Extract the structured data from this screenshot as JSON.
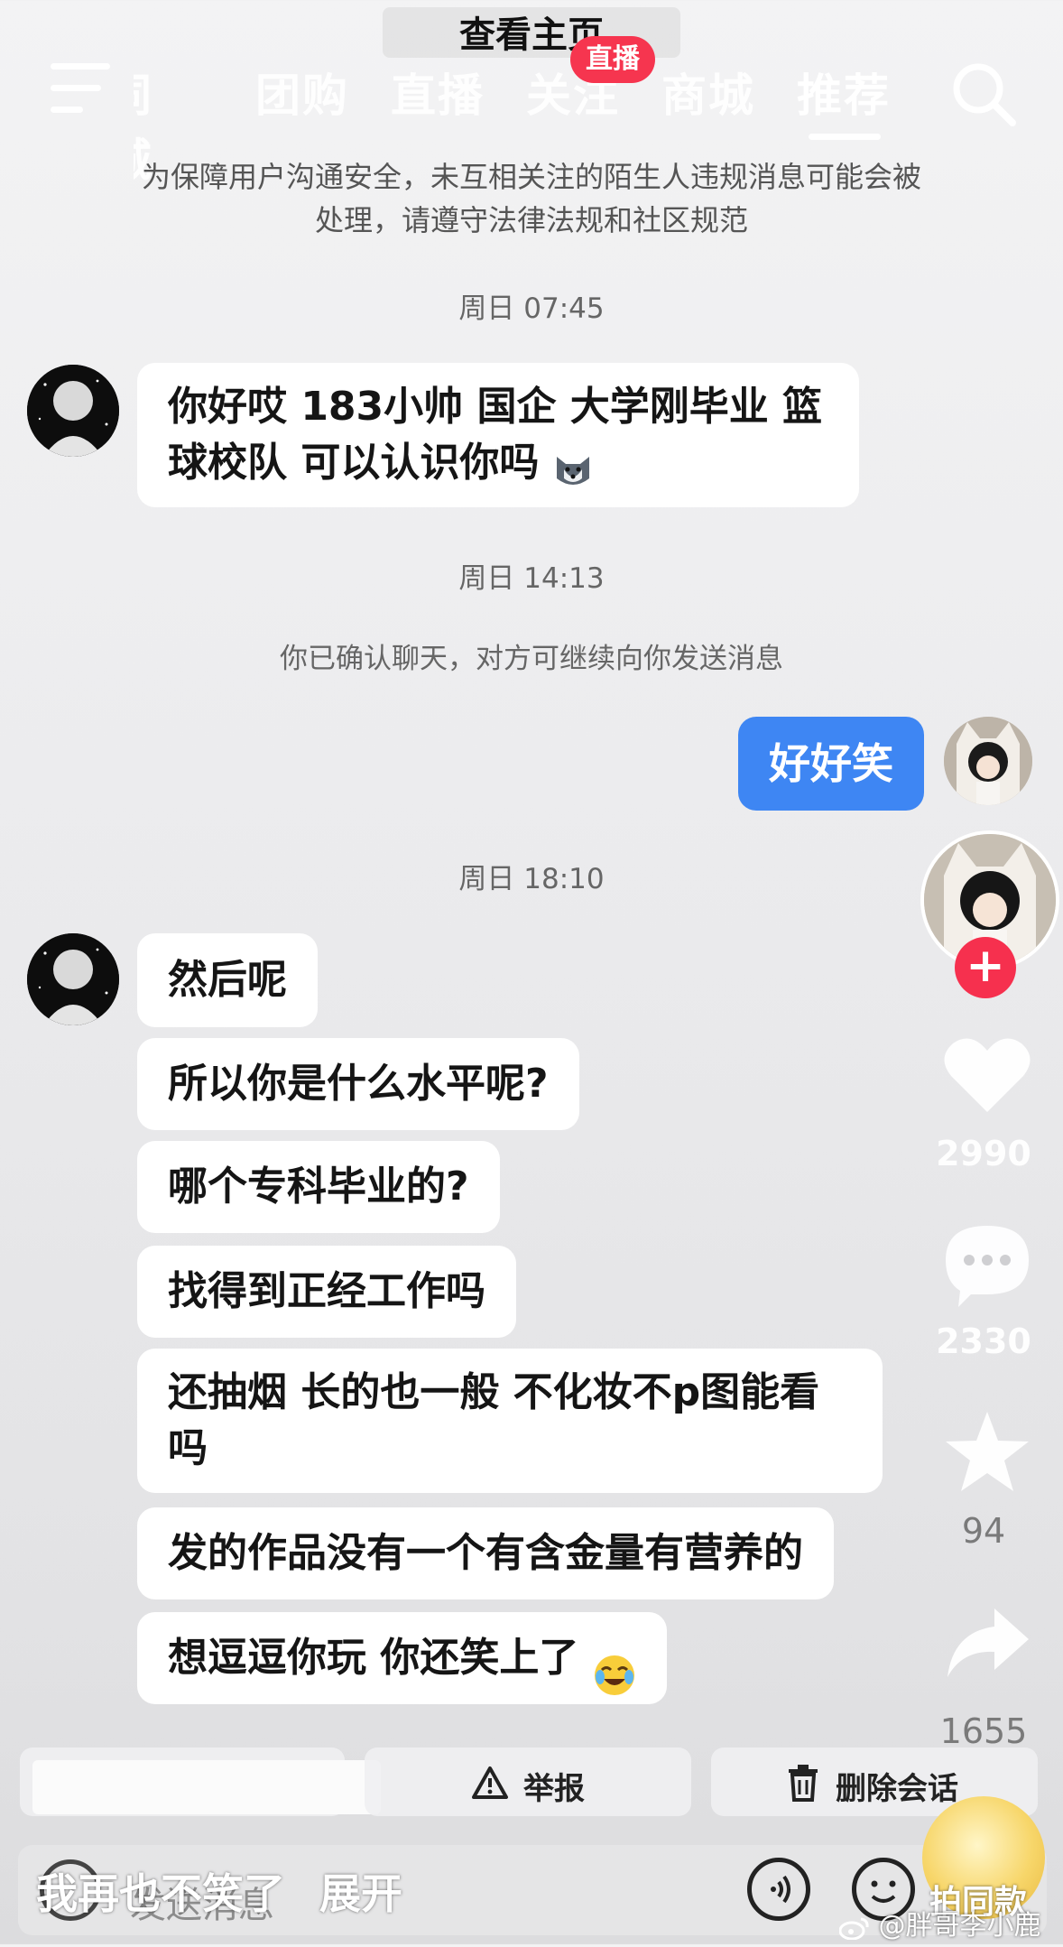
{
  "header": {
    "title": "查看主页",
    "tabs": [
      {
        "label": "同城"
      },
      {
        "label": "团购"
      },
      {
        "label": "直播"
      },
      {
        "label": "关注"
      },
      {
        "label": "商城"
      },
      {
        "label": "推荐",
        "active": true
      }
    ],
    "live_badge": "直播",
    "icons": [
      "menu-icon",
      "search-icon"
    ]
  },
  "chat": {
    "notice_line1": "为保障用户沟通安全，未互相关注的陌生人违规消息可能会被",
    "notice_line2": "处理，请遵守法律法规和社区规范",
    "timestamps": [
      "周日 07:45",
      "周日 14:13",
      "周日 18:10"
    ],
    "system_message": "你已确认聊天，对方可继续向你发送消息",
    "incoming_first_line1": "你好哎 183小帅 国企 大学刚毕业 篮",
    "incoming_first_line2": "球校队 可以认识你吗",
    "outgoing": "好好笑",
    "incoming_later": [
      {
        "text": "然后呢"
      },
      {
        "text": "所以你是什么水平呢?"
      },
      {
        "text": "哪个专科毕业的?"
      },
      {
        "text": "找得到正经工作吗"
      },
      {
        "line1": "还抽烟 长的也一般  不化妆不p图能看",
        "line2": "吗"
      },
      {
        "text": "发的作品没有一个有含金量有营养的"
      },
      {
        "text": "想逗逗你玩 你还笑上了"
      }
    ]
  },
  "side_actions": {
    "likes": "2990",
    "comments": "2330",
    "favorites": "94",
    "shares": "1655",
    "follow_icon": "plus-icon"
  },
  "bottom": {
    "report": "举报",
    "delete_chat": "删除会话",
    "input_placeholder": "发送消息",
    "caption": "我再也不笑了",
    "expand": "展开",
    "sticker_label": "拍同款",
    "watermark": "@胖哥李小鹿"
  },
  "colors": {
    "outgoing_bubble": "#3e86f3",
    "live_badge": "#f6354f",
    "follow_plus": "#f6304e"
  }
}
